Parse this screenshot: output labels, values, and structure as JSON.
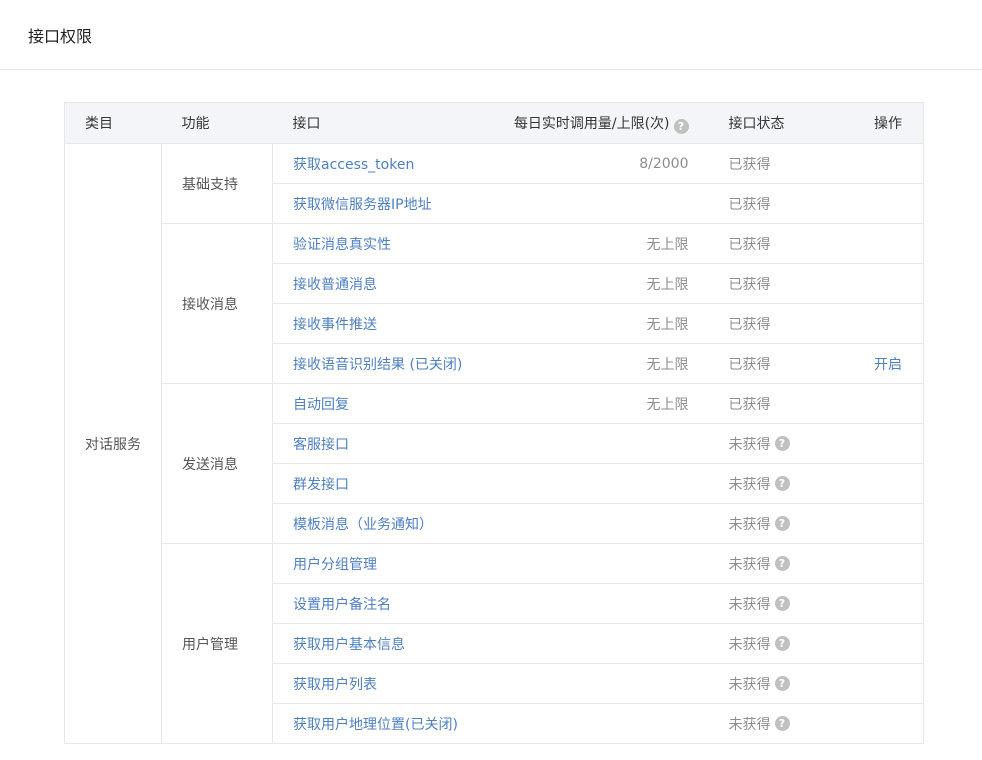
{
  "header": {
    "title": "接口权限"
  },
  "table": {
    "columns": {
      "category": "类目",
      "function": "功能",
      "api": "接口",
      "usage": "每日实时调用量/上限(次)",
      "status": "接口状态",
      "operation": "操作"
    },
    "category": "对话服务",
    "groups": [
      {
        "function": "基础支持",
        "rows": [
          {
            "api": "获取access_token",
            "usage": "8/2000",
            "status": "已获得",
            "help": false,
            "op": ""
          },
          {
            "api": "获取微信服务器IP地址",
            "usage": "",
            "status": "已获得",
            "help": false,
            "op": ""
          }
        ]
      },
      {
        "function": "接收消息",
        "rows": [
          {
            "api": "验证消息真实性",
            "usage": "无上限",
            "status": "已获得",
            "help": false,
            "op": ""
          },
          {
            "api": "接收普通消息",
            "usage": "无上限",
            "status": "已获得",
            "help": false,
            "op": ""
          },
          {
            "api": "接收事件推送",
            "usage": "无上限",
            "status": "已获得",
            "help": false,
            "op": ""
          },
          {
            "api": "接收语音识别结果 (已关闭)",
            "usage": "无上限",
            "status": "已获得",
            "help": false,
            "op": "开启"
          }
        ]
      },
      {
        "function": "发送消息",
        "rows": [
          {
            "api": "自动回复",
            "usage": "无上限",
            "status": "已获得",
            "help": false,
            "op": ""
          },
          {
            "api": "客服接口",
            "usage": "",
            "status": "未获得",
            "help": true,
            "op": ""
          },
          {
            "api": "群发接口",
            "usage": "",
            "status": "未获得",
            "help": true,
            "op": ""
          },
          {
            "api": "模板消息（业务通知）",
            "usage": "",
            "status": "未获得",
            "help": true,
            "op": ""
          }
        ]
      },
      {
        "function": "用户管理",
        "rows": [
          {
            "api": "用户分组管理",
            "usage": "",
            "status": "未获得",
            "help": true,
            "op": ""
          },
          {
            "api": "设置用户备注名",
            "usage": "",
            "status": "未获得",
            "help": true,
            "op": ""
          },
          {
            "api": "获取用户基本信息",
            "usage": "",
            "status": "未获得",
            "help": true,
            "op": ""
          },
          {
            "api": "获取用户列表",
            "usage": "",
            "status": "未获得",
            "help": true,
            "op": ""
          },
          {
            "api": "获取用户地理位置(已关闭)",
            "usage": "",
            "status": "未获得",
            "help": true,
            "op": ""
          }
        ]
      }
    ]
  },
  "icons": {
    "help": "question-circle-icon"
  }
}
